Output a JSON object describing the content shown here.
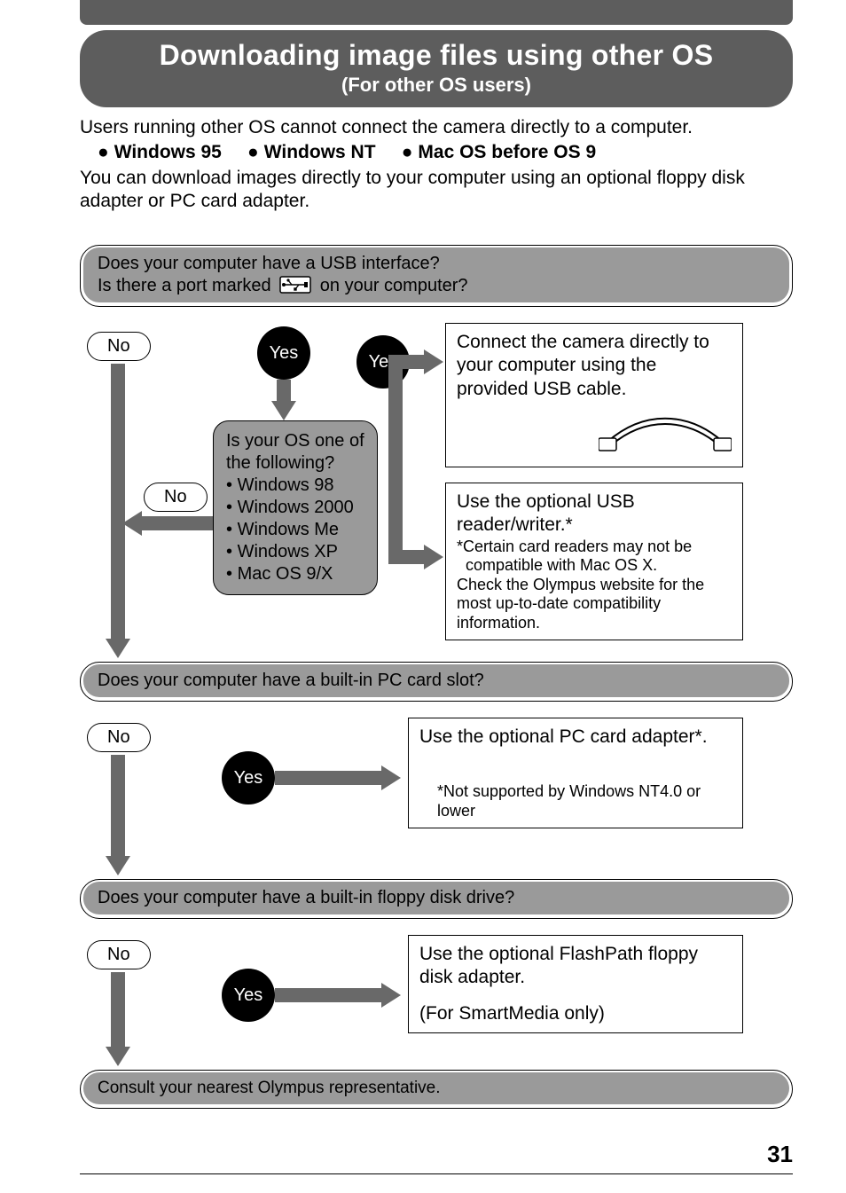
{
  "title": {
    "main": "Downloading image files using other OS",
    "sub": "(For other OS users)"
  },
  "intro": {
    "line1": "Users running other OS cannot connect the camera directly to a computer.",
    "os1": "Windows 95",
    "os2": "Windows NT",
    "os3": "Mac OS before OS 9",
    "line2": "You can download images directly to your computer using an optional floppy disk adapter or PC card adapter."
  },
  "q1": {
    "line1": "Does your computer have a USB interface?",
    "line2a": "Is there a port marked",
    "line2b": "on your computer?"
  },
  "labels": {
    "no": "No",
    "yes": "Yes"
  },
  "os_check": {
    "lead1": "Is your OS one of",
    "lead2": "the following?",
    "items": [
      "Windows 98",
      "Windows 2000",
      "Windows Me",
      "Windows XP",
      "Mac OS 9/X"
    ]
  },
  "box_usb_connect": "Connect the camera directly to your computer using the provided USB cable.",
  "box_usb_reader": {
    "line1": "Use the optional USB reader/writer.*",
    "note_star": "Certain card readers may not be compatible with Mac OS X.",
    "note2": "Check the Olympus website for the most up-to-date compatibility information."
  },
  "q2": "Does your computer have a built-in PC card slot?",
  "box_pc_card": {
    "line": "Use the optional PC card adapter*.",
    "note": "*Not supported by Windows NT4.0 or lower"
  },
  "q3": "Does your computer have a built-in floppy disk drive?",
  "box_floppy": {
    "line1": "Use the optional FlashPath floppy disk adapter.",
    "line2": "(For SmartMedia only)"
  },
  "q4": "Consult your nearest Olympus representative.",
  "page_number": "31"
}
